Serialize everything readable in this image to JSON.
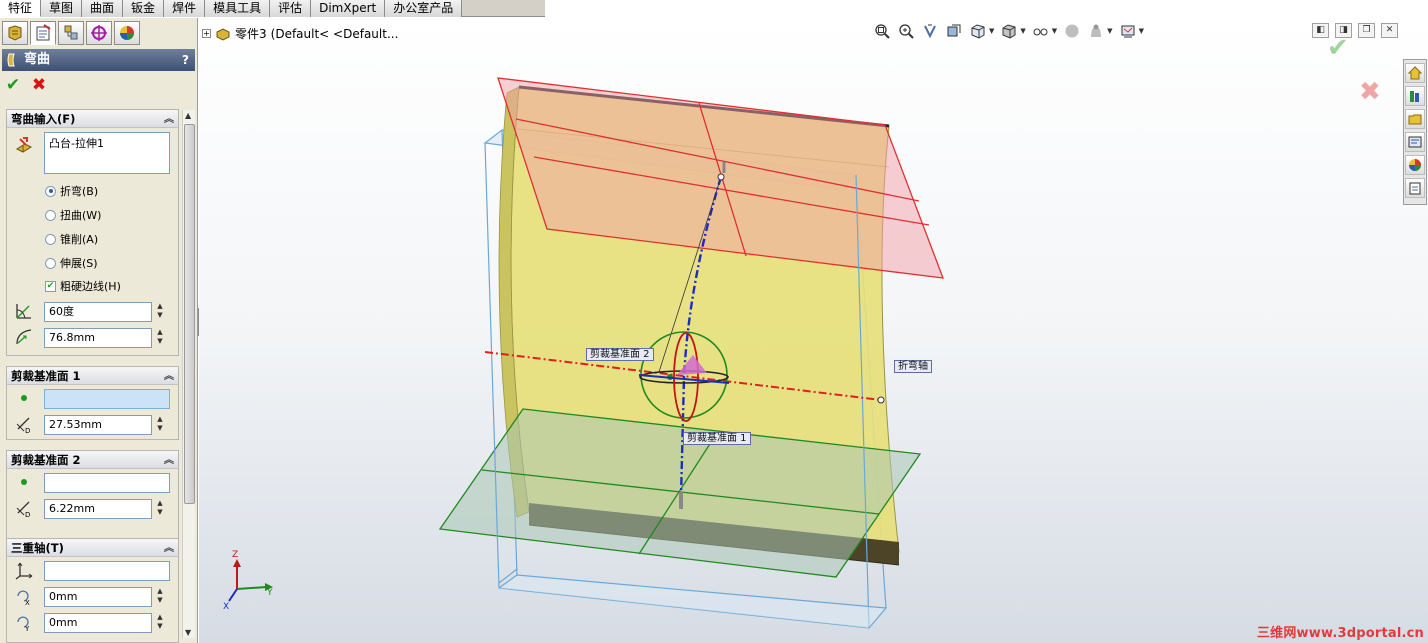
{
  "command_tabs": [
    "特征",
    "草图",
    "曲面",
    "钣金",
    "焊件",
    "模具工具",
    "评估",
    "DimXpert",
    "办公室产品"
  ],
  "panel_header": {
    "title": "弯曲",
    "help": "?"
  },
  "bend_input": {
    "title": "弯曲输入(F)",
    "body": "凸台-拉伸1",
    "options": [
      {
        "label": "折弯(B)",
        "checked": true
      },
      {
        "label": "扭曲(W)",
        "checked": false
      },
      {
        "label": "锥削(A)",
        "checked": false
      },
      {
        "label": "伸展(S)",
        "checked": false
      }
    ],
    "hard_edges": {
      "label": "粗硬边线(H)",
      "checked": true
    },
    "angle": "60度",
    "radius": "76.8mm"
  },
  "trim_plane_1": {
    "title": "剪裁基准面 1",
    "selection": "",
    "distance": "27.53mm"
  },
  "trim_plane_2": {
    "title": "剪裁基准面 2",
    "selection": "",
    "distance": "6.22mm"
  },
  "triad": {
    "title": "三重轴(T)",
    "selection": "",
    "rot_x": "0mm",
    "rot_y": "0mm"
  },
  "tree_flyout": {
    "part_label": "零件3",
    "config_label": "(Default< <Default..."
  },
  "viewport_tags": {
    "trim_plane_2": "剪裁基准面 2",
    "trim_plane_1": "剪裁基准面 1",
    "bend_axis": "折弯轴"
  },
  "triad_axes": {
    "x": "X",
    "y": "Y",
    "z": "Z"
  },
  "watermark": "三维网www.3dportal.cn",
  "colors": {
    "upper_plane": "#e03030",
    "lower_plane": "#1f8a1f",
    "body": "#e6e07a",
    "bounding_box": "#6aa8d8",
    "axis": "#1b2dbf"
  }
}
